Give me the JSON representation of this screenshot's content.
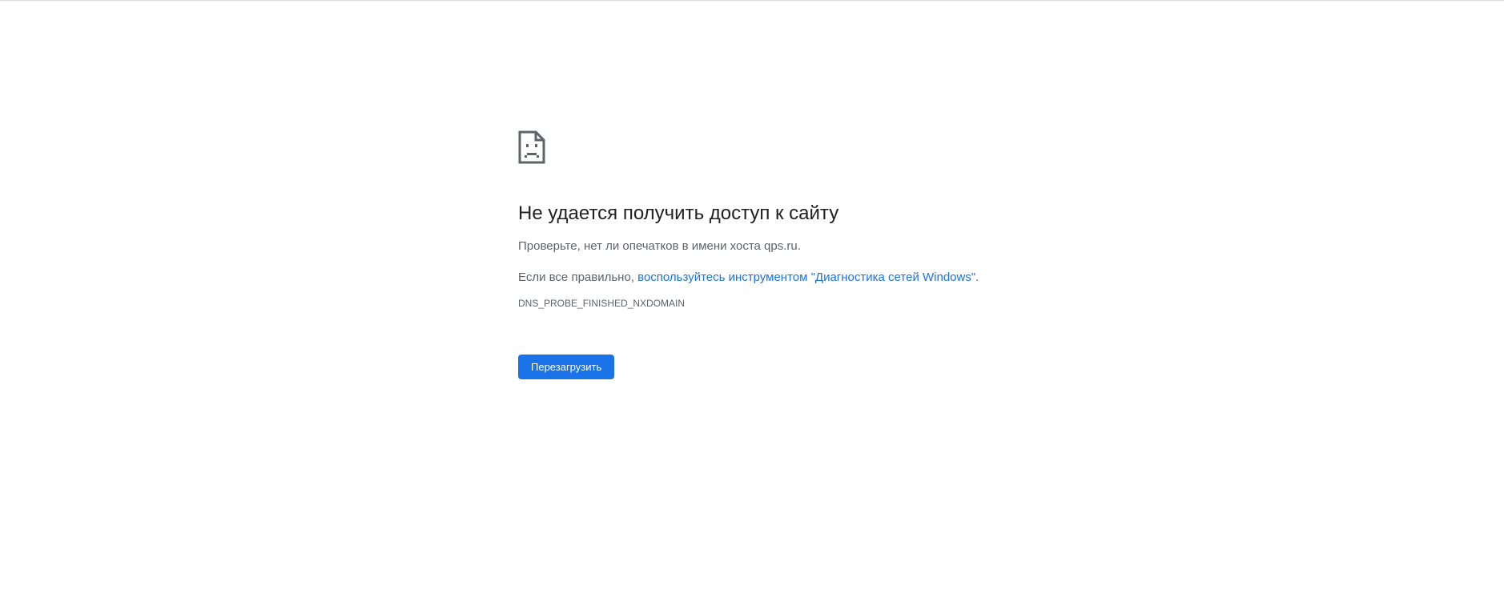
{
  "page": {
    "background": "#ffffff"
  },
  "error": {
    "icon": "sad-page-icon",
    "title": "Не удается получить доступ к сайту",
    "check_text": "Проверьте, нет ли опечатков в имени хоста qps.ru.",
    "diagnostic_prefix": "Если все правильно, ",
    "diagnostic_link": "воспользуйтесь инструментом \"Диагностика сетей Windows\"",
    "diagnostic_suffix": ".",
    "code": "DNS_PROBE_FINISHED_NXDOMAIN"
  },
  "actions": {
    "reload_label": "Перезагрузить"
  },
  "colors": {
    "accent": "#1a73e8",
    "title": "#202124",
    "secondary_text": "#5f6368"
  }
}
